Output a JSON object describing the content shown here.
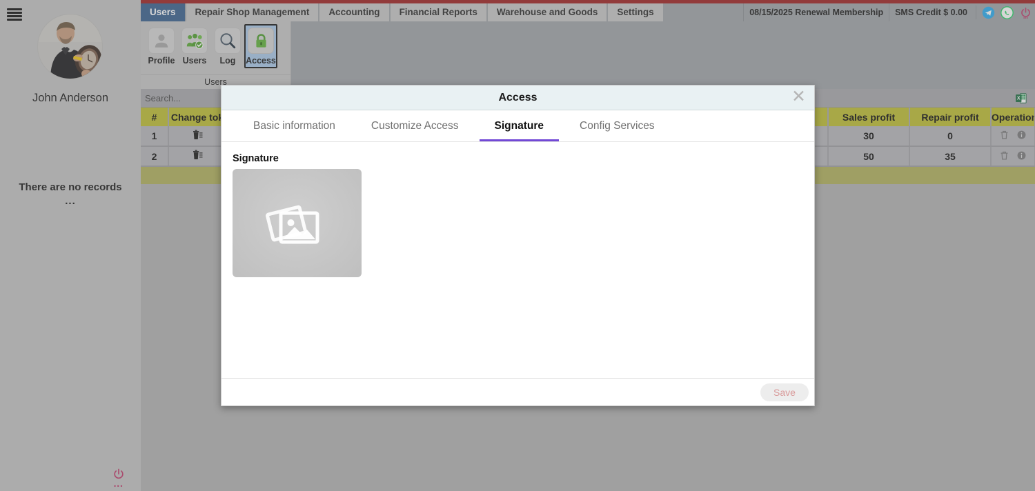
{
  "sidebar": {
    "menu_icon": "hamburger-icon",
    "user_name": "John Anderson",
    "empty_message": "There are no records",
    "empty_dots": "...",
    "power_icon": "power-icon"
  },
  "topbar": {
    "tabs": [
      {
        "label": "Users",
        "active": true
      },
      {
        "label": "Repair Shop Management",
        "active": false
      },
      {
        "label": "Accounting",
        "active": false
      },
      {
        "label": "Financial Reports",
        "active": false
      },
      {
        "label": "Warehouse and Goods",
        "active": false
      },
      {
        "label": "Settings",
        "active": false
      }
    ],
    "renewal": "08/15/2025 Renewal Membership",
    "sms_credit": "SMS Credit $ 0.00",
    "icons": [
      "telegram-icon",
      "whatsapp-icon",
      "power-icon"
    ],
    "accent_red": "#9e2121",
    "active_tab_blue": "#38618f"
  },
  "ribbon": {
    "group_caption": "Users",
    "buttons": [
      {
        "label": "Profile",
        "icon": "person-icon",
        "selected": false
      },
      {
        "label": "Users",
        "icon": "users-group-check-icon",
        "selected": false
      },
      {
        "label": "Log",
        "icon": "magnifier-icon",
        "selected": false
      },
      {
        "label": "Access",
        "icon": "lock-icon",
        "selected": true
      }
    ]
  },
  "search": {
    "placeholder": "Search...",
    "value": "",
    "export_icon": "excel-export-icon"
  },
  "table": {
    "columns": [
      "#",
      "Change tok",
      "",
      "",
      "",
      "Sales profit",
      "Repair profit",
      "Operation"
    ],
    "rows": [
      {
        "num": "1",
        "change_token": "trash-list-icon",
        "sales_profit": "30",
        "repair_profit": "0",
        "operations": [
          "trash-icon",
          "info-icon"
        ]
      },
      {
        "num": "2",
        "change_token": "trash-list-icon",
        "sales_profit": "50",
        "repair_profit": "35",
        "operations": [
          "trash-icon",
          "info-icon"
        ]
      }
    ],
    "header_color": "#bdbd33",
    "footer_color": "#b0b05c"
  },
  "modal": {
    "title": "Access",
    "close_icon": "close-icon",
    "tabs": [
      {
        "label": "Basic information",
        "active": false
      },
      {
        "label": "Customize Access",
        "active": false
      },
      {
        "label": "Signature",
        "active": true
      },
      {
        "label": "Config Services",
        "active": false
      }
    ],
    "active_tab_underline": "#7249d6",
    "signature_label": "Signature",
    "signature_placeholder_icon": "image-placeholder-icon",
    "save_label": "Save"
  }
}
